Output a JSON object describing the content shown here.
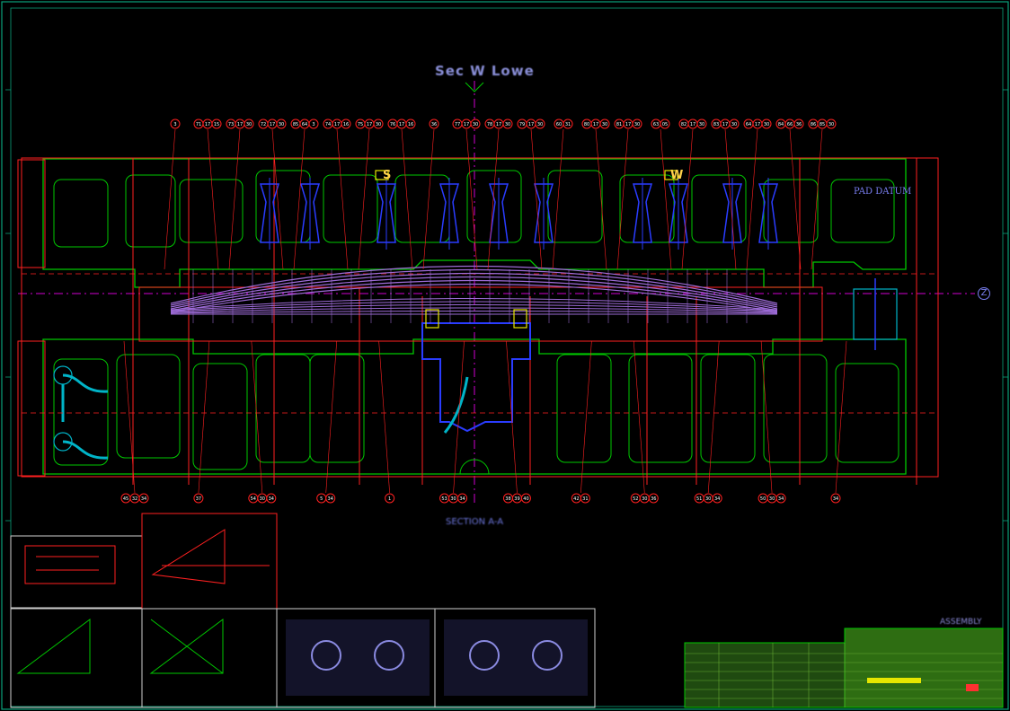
{
  "drawing": {
    "title": "Sec W Lowe",
    "pad_datum": "PAD DATUM",
    "axis_marker": "Z",
    "section_marks": [
      "S",
      "W"
    ],
    "sub_title": "SECTION A-A",
    "sheet_label": "ASSEMBLY"
  },
  "balloons_top": [
    [
      "3"
    ],
    [
      "71",
      "17",
      "15"
    ],
    [
      "73",
      "17",
      "30"
    ],
    [
      "72",
      "17",
      "30"
    ],
    [
      "85",
      "64",
      "3"
    ],
    [
      "74",
      "17",
      "16"
    ],
    [
      "75",
      "17",
      "30"
    ],
    [
      "76",
      "17",
      "16"
    ],
    [
      "36"
    ],
    [
      "77",
      "17",
      "30"
    ],
    [
      "78",
      "17",
      "30"
    ],
    [
      "79",
      "17",
      "30"
    ],
    [
      "60",
      "31"
    ],
    [
      "80",
      "17",
      "30"
    ],
    [
      "81",
      "17",
      "30"
    ],
    [
      "63",
      "05"
    ],
    [
      "82",
      "17",
      "30"
    ],
    [
      "83",
      "17",
      "30"
    ],
    [
      "64",
      "17",
      "30"
    ],
    [
      "84",
      "66",
      "36"
    ],
    [
      "86",
      "85",
      "30"
    ]
  ],
  "balloons_bottom": [
    [
      "45",
      "32",
      "34"
    ],
    [
      "37"
    ],
    [
      "54",
      "30",
      "34"
    ],
    [
      "5",
      "34"
    ],
    [
      "1"
    ],
    [
      "53",
      "30",
      "34"
    ],
    [
      "38",
      "39",
      "40"
    ],
    [
      "42",
      "31"
    ],
    [
      "52",
      "30",
      "36"
    ],
    [
      "51",
      "30",
      "34"
    ],
    [
      "50",
      "30",
      "34"
    ],
    [
      "34"
    ]
  ],
  "colors": {
    "frame": "#0aa07a",
    "body": "#00c800",
    "center": "#ff2020",
    "part": "#9d6bd6",
    "blue": "#2a3cff",
    "cyan": "#00b4c8",
    "yellow": "#e6e600",
    "magenta": "#d000d0"
  }
}
